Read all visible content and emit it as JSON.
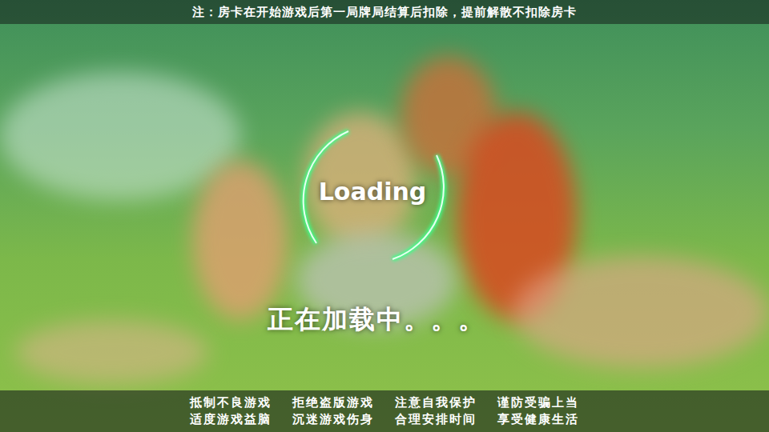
{
  "notice": "注：房卡在开始游戏后第一局牌局结算后扣除，提前解散不扣除房卡",
  "loading": {
    "label": "Loading",
    "message": "正在加载中。。。"
  },
  "advice": [
    [
      "抵制不良游戏",
      "拒绝盗版游戏",
      "注意自我保护",
      "谨防受骗上当"
    ],
    [
      "适度游戏益脑",
      "沉迷游戏伤身",
      "合理安排时间",
      "享受健康生活"
    ]
  ]
}
